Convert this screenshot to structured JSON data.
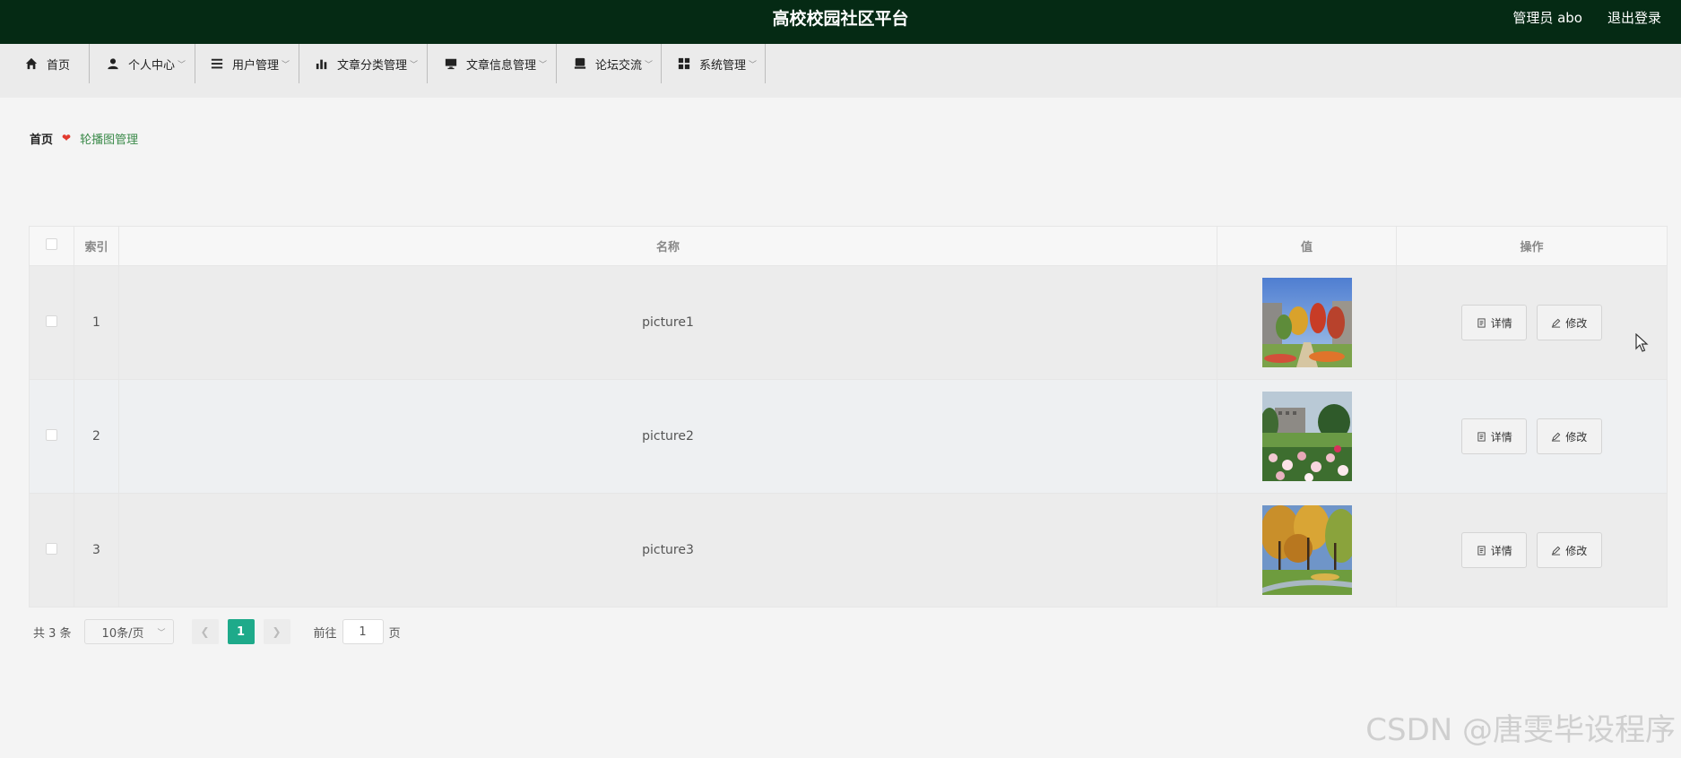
{
  "header": {
    "site_title": "高校校园社区平台",
    "admin_label": "管理员 abo",
    "logout_label": "退出登录",
    "bg_color": "#052a14"
  },
  "nav": {
    "items": [
      {
        "label": "首页",
        "icon": "home-icon",
        "has_dropdown": false
      },
      {
        "label": "个人中心",
        "icon": "user-icon",
        "has_dropdown": true
      },
      {
        "label": "用户管理",
        "icon": "list-icon",
        "has_dropdown": true
      },
      {
        "label": "文章分类管理",
        "icon": "bar-chart-icon",
        "has_dropdown": true
      },
      {
        "label": "文章信息管理",
        "icon": "monitor-icon",
        "has_dropdown": true
      },
      {
        "label": "论坛交流",
        "icon": "chat-icon",
        "has_dropdown": true
      },
      {
        "label": "系统管理",
        "icon": "grid-icon",
        "has_dropdown": true
      }
    ]
  },
  "breadcrumb": {
    "home": "首页",
    "current": "轮播图管理"
  },
  "table": {
    "headers": {
      "index": "索引",
      "name": "名称",
      "value": "值",
      "actions": "操作"
    },
    "rows": [
      {
        "index": "1",
        "name": "picture1",
        "image": "campus-autumn-trees-photo"
      },
      {
        "index": "2",
        "name": "picture2",
        "image": "campus-flower-garden-photo"
      },
      {
        "index": "3",
        "name": "picture3",
        "image": "campus-yellow-trees-photo"
      }
    ],
    "detail_label": "详情",
    "edit_label": "修改"
  },
  "pagination": {
    "total_label": "共 3 条",
    "page_size": "10条/页",
    "current_page": "1",
    "goto_label": "前往",
    "goto_value": "1",
    "page_unit": "页",
    "active_color": "#1eaa8a"
  },
  "watermark": "CSDN @唐雯毕设程序"
}
